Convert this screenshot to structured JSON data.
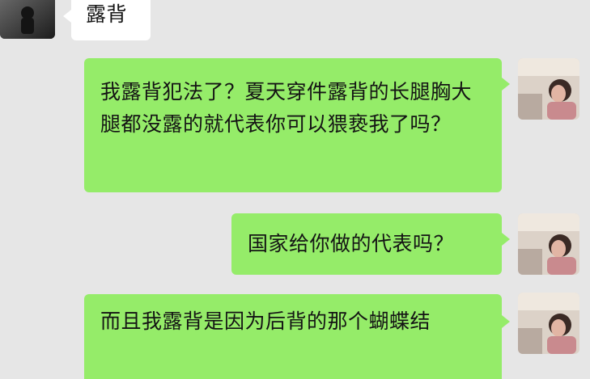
{
  "chat": {
    "incoming": {
      "text": "露背"
    },
    "outgoing": [
      {
        "text": "我露背犯法了？夏天穿件露背的长腿胸大腿都没露的就代表你可以猥亵我了吗？"
      },
      {
        "text": "国家给你做的代表吗？"
      },
      {
        "text": "而且我露背是因为后背的那个蝴蝶结"
      }
    ]
  },
  "colors": {
    "background": "#e6e6e6",
    "incoming_bubble": "#ffffff",
    "outgoing_bubble": "#95ec69"
  },
  "icons": {
    "contact_avatar": "contact-avatar-photo",
    "user_avatar": "user-avatar-photo"
  }
}
